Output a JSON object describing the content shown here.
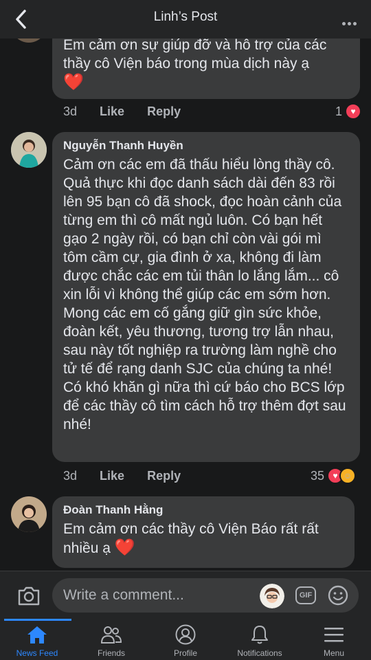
{
  "header": {
    "title": "Linh’s Post"
  },
  "comments": [
    {
      "text_line1": "Em cảm ơn sự giúp đỡ và hỗ trợ của các",
      "text_line2": "thầy cô Viện báo trong mùa dịch này ạ",
      "emoji": "❤️",
      "time": "3d",
      "like": "Like",
      "reply": "Reply",
      "reaction_count": "1"
    },
    {
      "author": "Nguyễn Thanh Huyền",
      "text": "Cảm ơn các em đã thấu hiểu lòng thầy cô. Quả thực khi đọc danh sách dài đến 83 rồi lên 95 bạn cô đã shock, đọc hoàn cảnh của từng em thì cô mất ngủ luôn. Có bạn hết gạo 2 ngày rồi, có bạn chỉ còn vài gói mì tôm cầm cự, gia đình ở xa, không đi làm được chắc các em tủi thân lo lắng lắm... cô xin lỗi vì không thể giúp các em sớm hơn. Mong các em cố gắng giữ gìn sức khỏe, đoàn kết, yêu thương, tương trợ lẫn nhau, sau này tốt nghiệp ra trường làm nghề cho tử tế để rạng danh SJC của chúng ta nhé! Có khó khăn gì nữa thì cứ báo cho BCS lớp để các thầy cô tìm cách hỗ trợ thêm đợt sau nhé!",
      "time": "3d",
      "like": "Like",
      "reply": "Reply",
      "reaction_count": "35"
    },
    {
      "author": "Đoàn Thanh Hằng",
      "text": "Em cảm ơn các thầy cô Viện Báo rất rất nhiều ạ",
      "emoji": "❤️"
    }
  ],
  "composer": {
    "placeholder": "Write a comment...",
    "gif_label": "GIF"
  },
  "tabs": [
    {
      "label": "News Feed",
      "icon": "home-icon",
      "active": true
    },
    {
      "label": "Friends",
      "icon": "friends-icon"
    },
    {
      "label": "Profile",
      "icon": "profile-icon"
    },
    {
      "label": "Notifications",
      "icon": "bell-icon"
    },
    {
      "label": "Menu",
      "icon": "menu-icon"
    }
  ],
  "colors": {
    "accent": "#2d88ff",
    "heart": "#f33e58",
    "bubble": "#3a3b3c",
    "background": "#18191a"
  }
}
